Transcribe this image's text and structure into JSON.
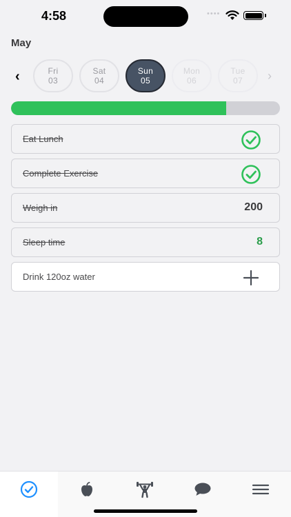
{
  "status_bar": {
    "time": "4:58",
    "signal_dots": "••••"
  },
  "header": {
    "month": "May"
  },
  "days": [
    {
      "dow": "Fri",
      "date": "03",
      "state": "normal"
    },
    {
      "dow": "Sat",
      "date": "04",
      "state": "normal"
    },
    {
      "dow": "Sun",
      "date": "05",
      "state": "selected"
    },
    {
      "dow": "Mon",
      "date": "06",
      "state": "faded"
    },
    {
      "dow": "Tue",
      "date": "07",
      "state": "faded"
    }
  ],
  "nav": {
    "prev": "‹",
    "next": "›"
  },
  "progress": {
    "fraction": 0.8,
    "fill_color": "#2fc15a",
    "track_color": "#d1d1d6"
  },
  "tasks": [
    {
      "label": "Eat Lunch",
      "done": true,
      "indicator": "check-icon"
    },
    {
      "label": "Complete Exercise",
      "done": true,
      "indicator": "check-icon"
    },
    {
      "label": "Weigh in",
      "done": true,
      "value": "200"
    },
    {
      "label": "Sleep time",
      "done": true,
      "value": "8"
    },
    {
      "label": "Drink 120oz water",
      "done": false,
      "indicator": "plus-icon"
    }
  ],
  "tab_bar": {
    "tabs": [
      {
        "icon": "checkmark-circle-icon",
        "selected": true
      },
      {
        "icon": "apple-icon",
        "selected": false
      },
      {
        "icon": "weightlifter-icon",
        "selected": false
      },
      {
        "icon": "chat-bubble-icon",
        "selected": false
      },
      {
        "icon": "menu-icon",
        "selected": false
      }
    ]
  },
  "colors": {
    "accent_blue": "#1e90ff",
    "done_green": "#2fc15a",
    "icon_gray": "#4a4f57"
  }
}
